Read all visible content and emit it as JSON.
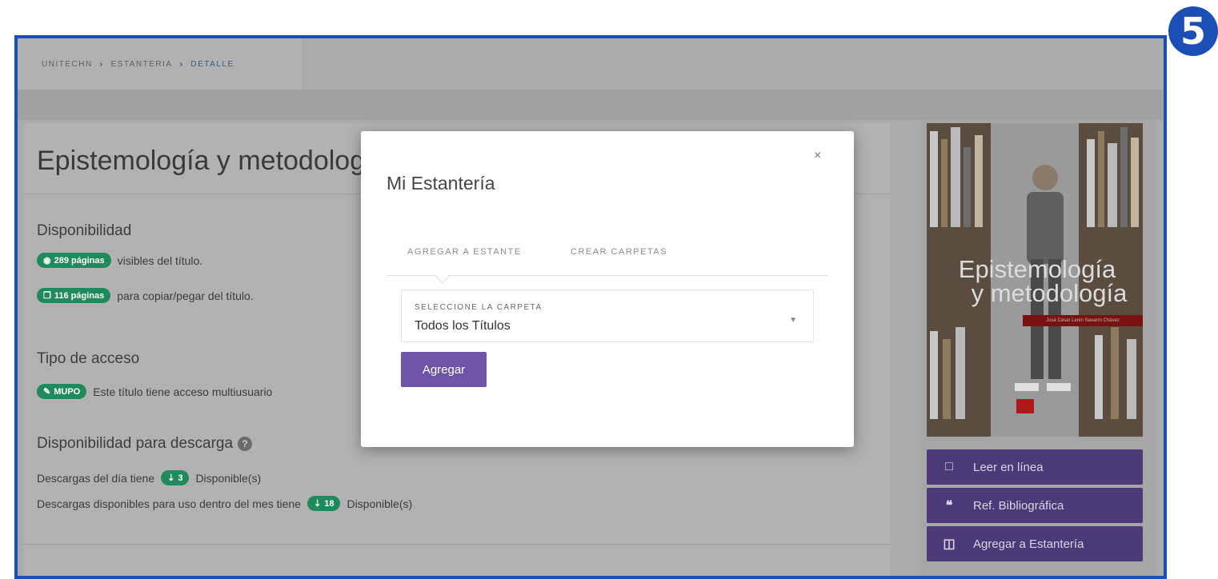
{
  "step_badge": "5",
  "breadcrumb": {
    "items": [
      "UNITECHN",
      "ESTANTERIA"
    ],
    "current": "DETALLE",
    "separator": "›"
  },
  "book": {
    "title": "Epistemología y metodología",
    "availability": {
      "heading": "Disponibilidad",
      "visible_pages_badge": "289 páginas",
      "visible_pages_text": "visibles del título.",
      "copy_pages_badge": "116 páginas",
      "copy_pages_text": "para copiar/pegar del título."
    },
    "access": {
      "heading": "Tipo de acceso",
      "badge": "MUPO",
      "text": "Este título tiene acceso multiusuario"
    },
    "download": {
      "heading": "Disponibilidad para descarga",
      "help_icon": "question-icon",
      "daily_prefix": "Descargas del día tiene",
      "daily_count": "3",
      "daily_suffix": "Disponible(s)",
      "monthly_prefix": "Descargas disponibles para uso dentro del mes tiene",
      "monthly_count": "18",
      "monthly_suffix": "Disponible(s)"
    }
  },
  "cover": {
    "title_line1": "Epistemología",
    "title_line2": "y metodología",
    "author": "José César Lenin Navarro Chávez"
  },
  "side_buttons": [
    {
      "label": "Leer en línea",
      "icon": "book-icon"
    },
    {
      "label": "Ref. Bibliográfica",
      "icon": "quote-icon"
    },
    {
      "label": "Agregar a Estantería",
      "icon": "shelf-icon"
    }
  ],
  "modal": {
    "title": "Mi Estantería",
    "close": "×",
    "tabs": [
      "AGREGAR A ESTANTE",
      "CREAR CARPETAS"
    ],
    "select_label": "SELECCIONE LA CARPETA",
    "select_value": "Todos los Títulos",
    "submit": "Agregar"
  },
  "colors": {
    "frame_border": "#1b4fb5",
    "badge_green": "#1f8a5c",
    "button_purple": "#6c54a8",
    "side_button_purple": "#4c3a78"
  }
}
